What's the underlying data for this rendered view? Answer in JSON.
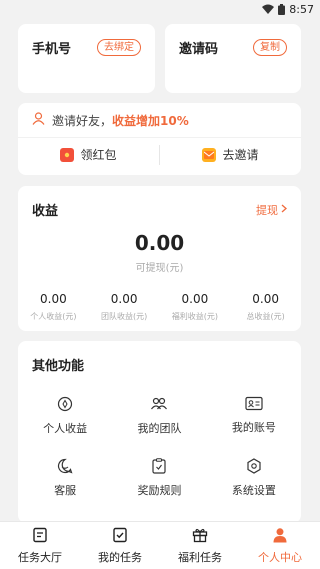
{
  "status_bar": {
    "time": "8:57",
    "icons": [
      "wifi-icon",
      "battery-icon"
    ]
  },
  "phone_card": {
    "title": "手机号",
    "action": "去绑定"
  },
  "invite_code_card": {
    "title": "邀请码",
    "action": "复制"
  },
  "invite_banner": {
    "text": "邀请好友，",
    "highlight": "收益增加10%",
    "left_button": "领红包",
    "right_button": "去邀请"
  },
  "earnings": {
    "title": "收益",
    "withdraw_link": "提现",
    "amount": "0.00",
    "amount_label": "可提现(元)",
    "stats": [
      {
        "value": "0.00",
        "label": "个人收益(元)"
      },
      {
        "value": "0.00",
        "label": "团队收益(元)"
      },
      {
        "value": "0.00",
        "label": "福利收益(元)"
      },
      {
        "value": "0.00",
        "label": "总收益(元)"
      }
    ]
  },
  "functions": {
    "title": "其他功能",
    "items": [
      {
        "label": "个人收益",
        "icon": "coin-icon"
      },
      {
        "label": "我的团队",
        "icon": "team-icon"
      },
      {
        "label": "我的账号",
        "icon": "id-card-icon"
      },
      {
        "label": "客服",
        "icon": "chat-icon"
      },
      {
        "label": "奖励规则",
        "icon": "rules-icon"
      },
      {
        "label": "系统设置",
        "icon": "settings-icon"
      }
    ]
  },
  "nav": {
    "items": [
      {
        "label": "任务大厅",
        "icon": "task-hall-icon"
      },
      {
        "label": "我的任务",
        "icon": "my-task-icon"
      },
      {
        "label": "福利任务",
        "icon": "gift-icon"
      },
      {
        "label": "个人中心",
        "icon": "person-icon"
      }
    ],
    "active_index": 3
  },
  "colors": {
    "accent": "#f06a3c",
    "background": "#f2f2f2"
  }
}
